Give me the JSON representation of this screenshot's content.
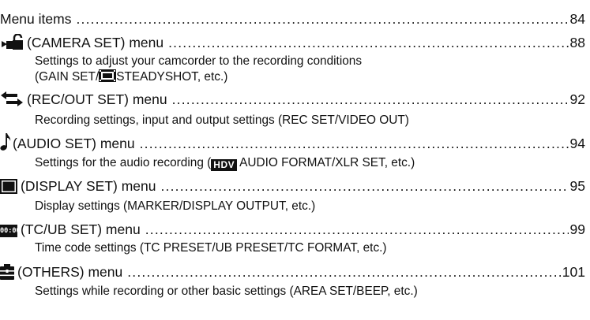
{
  "entries": [
    {
      "label": "Menu items",
      "page": "84"
    },
    {
      "label": "(CAMERA SET) menu",
      "page": "88",
      "icon": "camera-set-icon",
      "desc_line1": "Settings to adjust your camcorder to the recording conditions",
      "desc_line2_pre": "(GAIN SET/",
      "desc_line2_icon": "steadyshot-film-icon",
      "desc_line2_post": "STEADYSHOT, etc.)"
    },
    {
      "label": "(REC/OUT SET) menu",
      "page": "92",
      "icon": "rec-out-arrows-icon",
      "desc": "Recording settings, input and output settings (REC SET/VIDEO OUT)"
    },
    {
      "label": "(AUDIO SET) menu",
      "page": "94",
      "icon": "music-note-icon",
      "desc_pre": "Settings for the audio recording (",
      "desc_icon": "hdv-badge-icon",
      "desc_icon_text": "HDV",
      "desc_post": "AUDIO FORMAT/XLR SET, etc.)"
    },
    {
      "label": "(DISPLAY SET) menu",
      "page": "95",
      "icon": "display-set-icon",
      "desc": "Display settings (MARKER/DISPLAY OUTPUT, etc.)"
    },
    {
      "label": "(TC/UB SET) menu",
      "page": "99",
      "icon": "timecode-icon",
      "icon_text": "00:00",
      "desc": "Time code settings (TC PRESET/UB PRESET/TC FORMAT, etc.)"
    },
    {
      "label": "(OTHERS) menu",
      "page": "101",
      "icon": "others-toolbox-icon",
      "desc": "Settings while recording or other basic settings (AREA SET/BEEP, etc.)"
    }
  ]
}
